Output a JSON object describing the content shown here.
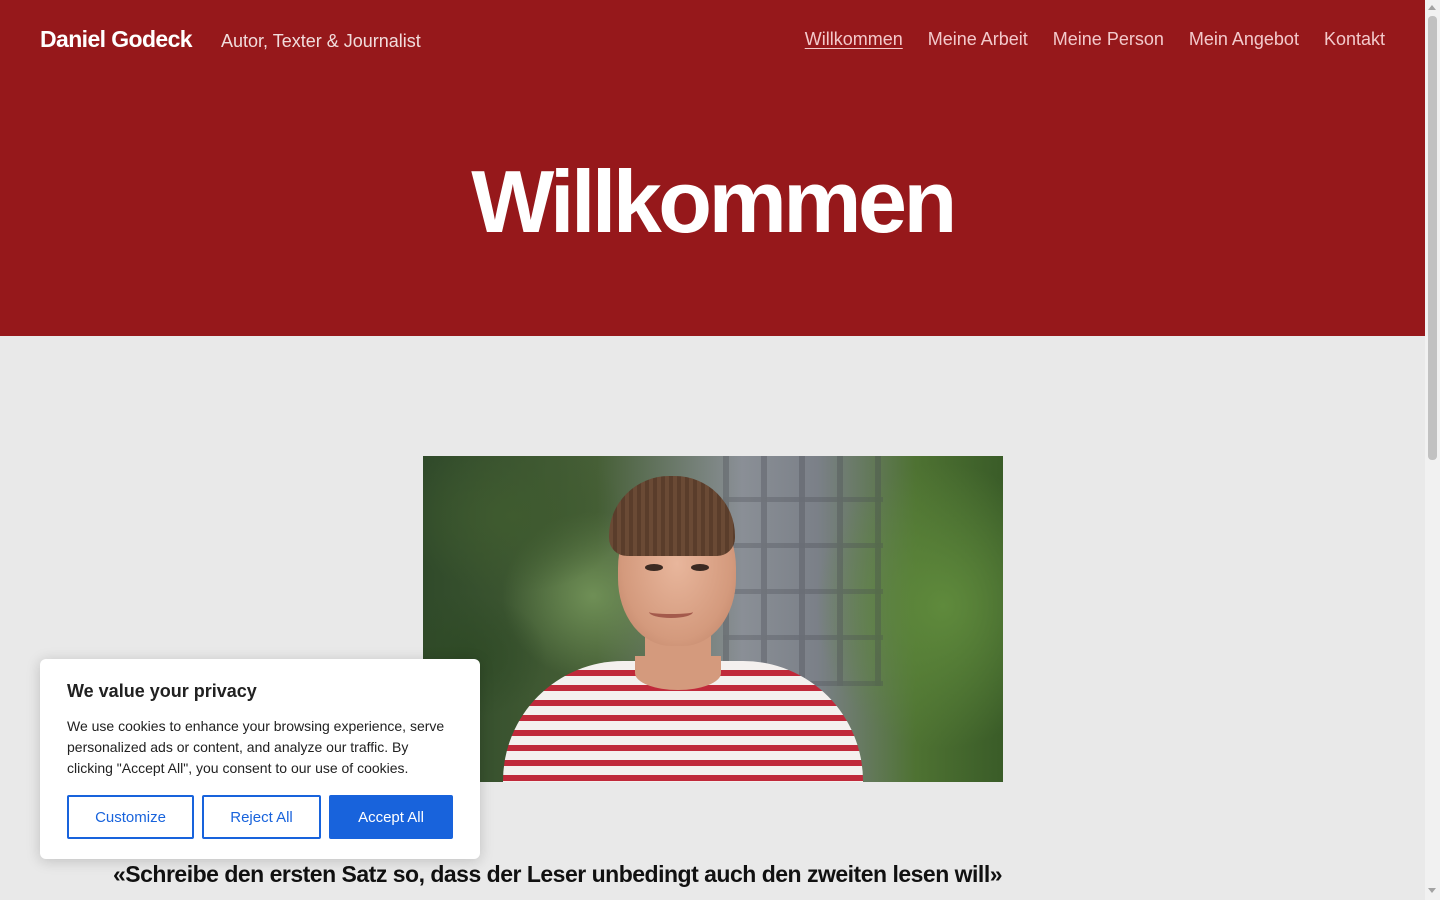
{
  "header": {
    "site_title": "Daniel Godeck",
    "tagline": "Autor, Texter & Journalist",
    "nav": [
      {
        "label": "Willkommen",
        "active": true
      },
      {
        "label": "Meine Arbeit",
        "active": false
      },
      {
        "label": "Meine Person",
        "active": false
      },
      {
        "label": "Mein Angebot",
        "active": false
      },
      {
        "label": "Kontakt",
        "active": false
      }
    ]
  },
  "hero": {
    "title": "Willkommen"
  },
  "main": {
    "quote": "«Schreibe den ersten Satz so, dass der Leser unbedingt auch den zweiten lesen will»"
  },
  "cookie_banner": {
    "title": "We value your privacy",
    "text": "We use cookies to enhance your browsing experience, serve personalized ads or content, and analyze our traffic. By clicking \"Accept All\", you consent to our use of cookies.",
    "customize_label": "Customize",
    "reject_label": "Reject All",
    "accept_label": "Accept All"
  },
  "colors": {
    "header_bg": "#96181b",
    "page_bg": "#e9e9e9",
    "accent_blue": "#1863dc"
  }
}
